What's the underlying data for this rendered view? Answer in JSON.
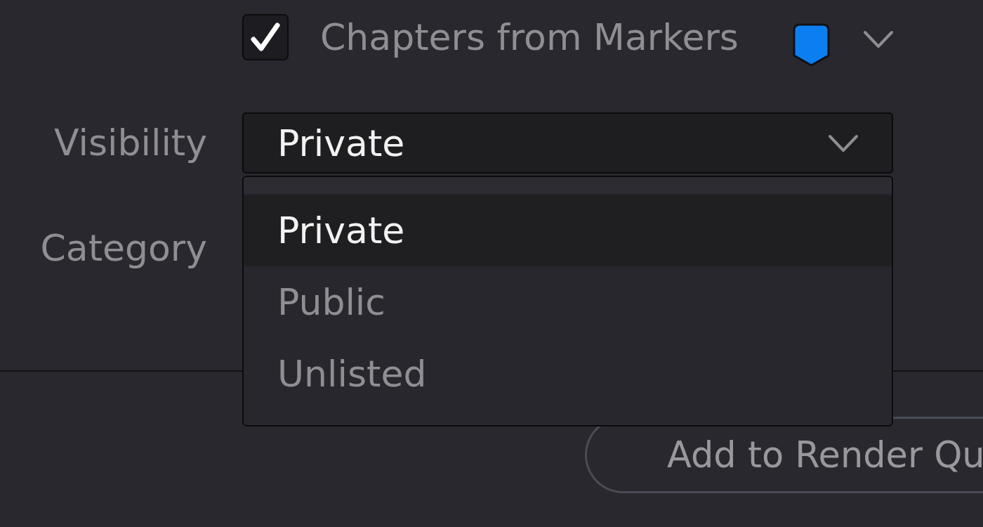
{
  "chapters_from_markers": {
    "label": "Chapters from Markers",
    "checked": true,
    "marker": {
      "color": "#0b7ff0"
    }
  },
  "visibility": {
    "label": "Visibility",
    "value": "Private",
    "expanded": true,
    "options": [
      {
        "label": "Private",
        "selected": true
      },
      {
        "label": "Public",
        "selected": false
      },
      {
        "label": "Unlisted",
        "selected": false
      }
    ]
  },
  "category": {
    "label": "Category"
  },
  "buttons": [
    {
      "label": "Add to Render Qu"
    }
  ]
}
